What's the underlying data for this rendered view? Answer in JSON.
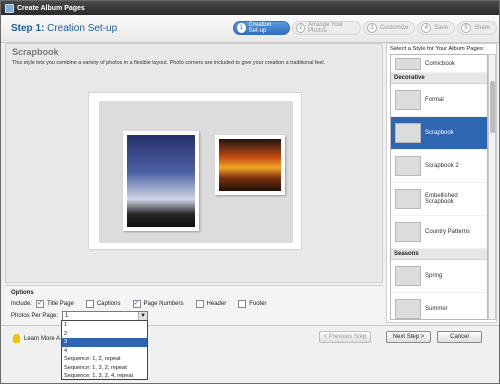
{
  "window": {
    "title": "Create Album Pages"
  },
  "header": {
    "step_label": "Step 1:",
    "step_title": "Creation Set-up",
    "steps": [
      {
        "num": "1",
        "label": "Creation Set-up"
      },
      {
        "num": "2",
        "label": "Arrange Your Photos"
      },
      {
        "num": "3",
        "label": "Customize"
      },
      {
        "num": "4",
        "label": "Save"
      },
      {
        "num": "5",
        "label": "Share"
      }
    ]
  },
  "main": {
    "style_name": "Scrapbook",
    "style_desc": "This style lets you combine a variety of photos in a flexible layout. Photo corners are included to give your creation a traditional feel."
  },
  "sidebar": {
    "label": "Select a Style for Your Album Pages:",
    "items": [
      {
        "type": "item",
        "label": "Comicbook"
      },
      {
        "type": "category",
        "label": "Decorative"
      },
      {
        "type": "item",
        "label": "Formal"
      },
      {
        "type": "item",
        "label": "Scrapbook",
        "selected": true
      },
      {
        "type": "item",
        "label": "Scrapbook 2"
      },
      {
        "type": "item",
        "label": "Embellished Scrapbook"
      },
      {
        "type": "item",
        "label": "Country Patterns"
      },
      {
        "type": "category",
        "label": "Seasons"
      },
      {
        "type": "item",
        "label": "Spring"
      },
      {
        "type": "item",
        "label": "Summer"
      }
    ]
  },
  "options": {
    "title": "Options",
    "include_label": "Include:",
    "checkboxes": [
      {
        "label": "Title Page",
        "checked": true
      },
      {
        "label": "Captions",
        "checked": false
      },
      {
        "label": "Page Numbers",
        "checked": true
      },
      {
        "label": "Header",
        "checked": false
      },
      {
        "label": "Footer",
        "checked": false
      }
    ],
    "photos_per_page_label": "Photos Per Page:",
    "photos_per_page_value": "1",
    "dropdown_options": [
      {
        "label": "1"
      },
      {
        "label": "2"
      },
      {
        "label": "3",
        "selected": true
      },
      {
        "label": "4"
      },
      {
        "label": "Sequence: 1, 2, repeat"
      },
      {
        "label": "Sequence: 1, 3, 2, repeat"
      },
      {
        "label": "Sequence: 1, 3, 2, 4, repeat"
      }
    ]
  },
  "footer": {
    "learn_more": "Learn More A",
    "prev_button": "< Previous Step",
    "next_button": "Next Step >",
    "cancel_button": "Cancel"
  }
}
